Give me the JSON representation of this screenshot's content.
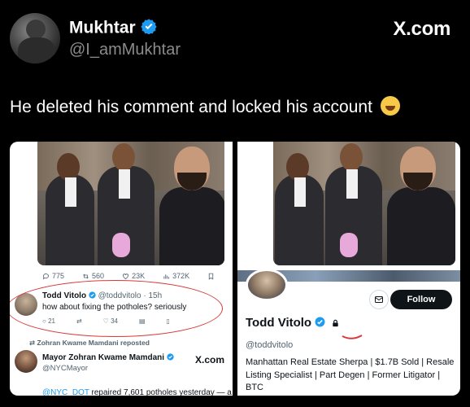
{
  "post": {
    "author_name": "Mukhtar",
    "author_handle": "@I_amMukhtar",
    "site_brand": "X.com",
    "text": "He deleted his comment and locked his account",
    "emoji": "rolling-on-floor-laughing-emoji"
  },
  "left_screenshot": {
    "metrics": {
      "replies": "775",
      "reposts": "560",
      "likes": "23K",
      "views": "372K"
    },
    "reply": {
      "name": "Todd Vitolo",
      "handle": "@toddvitolo · 15h",
      "text": "how about fixing the potholes? seriously",
      "replies": "21",
      "likes": "34"
    },
    "repost_line": "Zohran Kwame Mamdani reposted",
    "quoted": {
      "name": "Mayor Zohran Kwame Mamdani",
      "handle": "@NYCMayor",
      "brand": "X.com",
      "text_link": "@NYC_DOT",
      "text_rest": " repaired 7,601 potholes yesterday — a"
    }
  },
  "right_screenshot": {
    "follow_label": "Follow",
    "name": "Todd Vitolo",
    "handle": "@toddvitolo",
    "bio": "Manhattan Real Estate Sherpa | $1.7B Sold | Resale Listing Specialist | Part Degen | Former Litigator | BTC"
  },
  "colors": {
    "verified_blue": "#1d9bf0",
    "annotation_red": "#d73a3a",
    "background": "#000000"
  }
}
